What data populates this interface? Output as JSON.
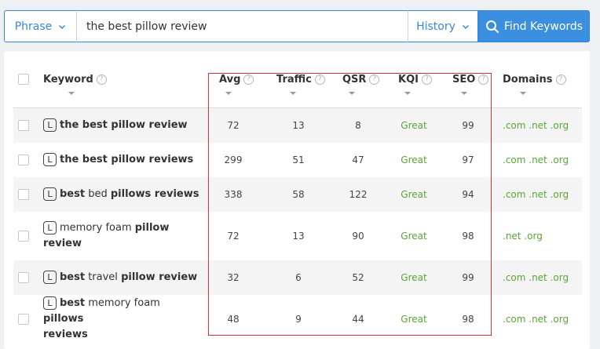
{
  "search": {
    "mode_label": "Phrase",
    "query": "the best pillow review",
    "history_label": "History",
    "find_label": "Find Keywords"
  },
  "table": {
    "headers": {
      "keyword": "Keyword",
      "avg": "Avg",
      "traffic": "Traffic",
      "qsr": "QSR",
      "kqi": "KQI",
      "seo": "SEO",
      "domains": "Domains"
    },
    "help_glyph": "?",
    "badge_letter": "L",
    "rows": [
      {
        "kw1": "the best pillow review",
        "kw2": "",
        "kw3": "",
        "kw4": "",
        "kw5": "",
        "avg": "72",
        "traffic": "13",
        "qsr": "8",
        "kqi": "Great",
        "seo": "99",
        "domains": ".com .net .org"
      },
      {
        "kw1": "the best pillow reviews",
        "kw2": "",
        "kw3": "",
        "kw4": "",
        "kw5": "",
        "avg": "299",
        "traffic": "51",
        "qsr": "47",
        "kqi": "Great",
        "seo": "97",
        "domains": ".com .net .org"
      },
      {
        "kw1": "best",
        "kw2": " bed ",
        "kw3": "pillows reviews",
        "kw4": "",
        "kw5": "",
        "avg": "338",
        "traffic": "58",
        "qsr": "122",
        "kqi": "Great",
        "seo": "94",
        "domains": ".com .net .org"
      },
      {
        "kw1": "",
        "kw2": "memory foam ",
        "kw3": "pillow",
        "kw4": "",
        "kw5": "review",
        "avg": "72",
        "traffic": "13",
        "qsr": "90",
        "kqi": "Great",
        "seo": "98",
        "domains": ".net .org"
      },
      {
        "kw1": "best",
        "kw2": " travel ",
        "kw3": "pillow review",
        "kw4": "",
        "kw5": "",
        "avg": "32",
        "traffic": "6",
        "qsr": "52",
        "kqi": "Great",
        "seo": "99",
        "domains": ".com .net .org"
      },
      {
        "kw1": "best",
        "kw2": " memory foam ",
        "kw3": "pillows",
        "kw4": "",
        "kw5": "reviews",
        "avg": "48",
        "traffic": "9",
        "qsr": "44",
        "kqi": "Great",
        "seo": "98",
        "domains": ".com .net .org"
      }
    ]
  },
  "colors": {
    "accent": "#3a8fe0",
    "great": "#5aa537",
    "highlight": "#d0343a"
  }
}
